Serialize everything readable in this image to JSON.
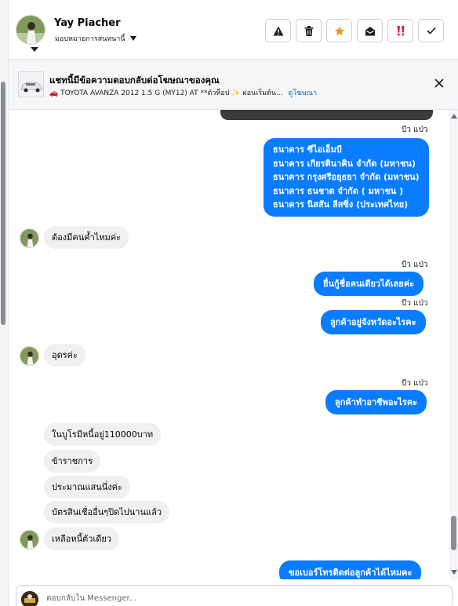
{
  "user": {
    "name": "Yay Piacher",
    "assign_label": "มอบหมายการสนทนานี้"
  },
  "actions": [
    {
      "name": "flag-button",
      "icon": "warning-icon"
    },
    {
      "name": "delete-button",
      "icon": "trash-icon"
    },
    {
      "name": "star-button",
      "icon": "star-icon",
      "color": "#f7931e"
    },
    {
      "name": "mark-unread-button",
      "icon": "envelope-open-icon"
    },
    {
      "name": "follow-up-button",
      "icon": "double-exclamation-icon",
      "color": "#e41e3f"
    },
    {
      "name": "mark-done-button",
      "icon": "check-icon"
    }
  ],
  "ad": {
    "title": "แชทนี้มีข้อความตอบกลับต่อโฆษณาของคุณ",
    "subtitle": "🚗 TOYOTA AVANZA 2012 1.5 G (MY12) AT **ตัวท็อป ✨ ผ่อนเริ่มต้น...",
    "link": "ดูโฆษณา"
  },
  "messages": {
    "seen_label": "บีว แป่ว",
    "banks": [
      "ธนาคาร ซีไอเอ็มบี",
      "ธนาคาร เกียรตินาคิน จำกัด (มหาชน)",
      "ธนาคาร กรุงศรีอยุธยา จำกัด (มหาชน)",
      "ธนาคาร ธนชาต จำกัด ( มหาชน )",
      "ธนาคาร นิสสัน ลีสซิ่ง (ประเทศไทย)"
    ],
    "in_1": "ต้องมีคนค้ำไหมค่ะ",
    "out_1": "ยื่นกู้ชื่อคนเดียวได้เลยค่ะ",
    "out_2": "ลูกค้าอยู่จังหวัดอะไรคะ",
    "in_2": "อุดรค่ะ",
    "out_3": "ลูกค้าทำอาชีพอะไรคะ",
    "in_3": "ในบูโรมีหนี้อยู่110000บาท",
    "in_4": "ข้าราชการ",
    "in_5": "ประมาณแสนนึ่งค่ะ",
    "in_6": "บัตรสินเชื่ออื่นๆปิดไปนานแล้ว",
    "in_7": "เหลือหนี้ตัวเดียว",
    "out_4": "ขอเบอร์โทรติดต่อลูกค้าได้ไหมคะ"
  },
  "reply": {
    "placeholder": "ตอบกลับใน Messenger..."
  },
  "colors": {
    "outgoing_bubble": "#0a7cff",
    "incoming_bubble": "#f0f0f0",
    "link": "#0a66c2"
  }
}
